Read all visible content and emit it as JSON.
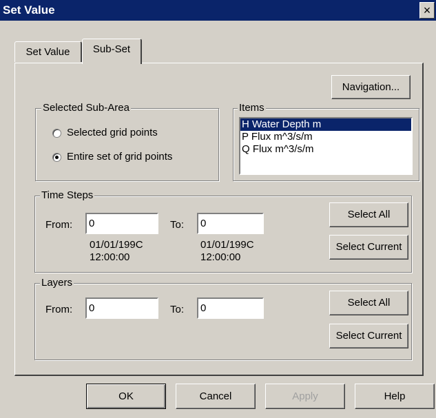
{
  "window": {
    "title": "Set Value",
    "close_glyph": "×"
  },
  "tabs": [
    {
      "label": "Set Value"
    },
    {
      "label": "Sub-Set"
    }
  ],
  "navigation_label": "Navigation...",
  "subarea": {
    "legend": "Selected Sub-Area",
    "options": [
      {
        "label": "Selected grid points",
        "checked": false
      },
      {
        "label": "Entire set of grid points",
        "checked": true
      }
    ]
  },
  "items": {
    "legend": "Items",
    "entries": [
      "H Water Depth m",
      "P Flux m^3/s/m",
      "Q Flux m^3/s/m"
    ],
    "selected_index": 0
  },
  "time_steps": {
    "legend": "Time Steps",
    "from_label": "From:",
    "to_label": "To:",
    "from_value": "0",
    "to_value": "0",
    "from_date": "01/01/199C",
    "from_time": "12:00:00",
    "to_date": "01/01/199C",
    "to_time": "12:00:00",
    "select_all": "Select All",
    "select_current": "Select Current"
  },
  "layers": {
    "legend": "Layers",
    "from_label": "From:",
    "to_label": "To:",
    "from_value": "0",
    "to_value": "0",
    "select_all": "Select All",
    "select_current": "Select Current"
  },
  "buttons": {
    "ok": "OK",
    "cancel": "Cancel",
    "apply": "Apply",
    "help": "Help"
  },
  "colors": {
    "face": "#d4d0c8",
    "title_bar": "#0a246a",
    "selection": "#0a246a"
  }
}
